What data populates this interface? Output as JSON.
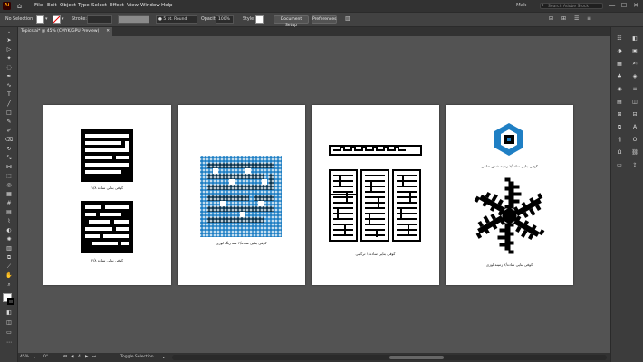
{
  "app": {
    "logo": "Ai",
    "home_icon": "home-icon"
  },
  "menu": [
    "File",
    "Edit",
    "Object",
    "Type",
    "Select",
    "Effect",
    "View",
    "Window",
    "Help"
  ],
  "workspace": "Mak",
  "search": {
    "placeholder": "Search Adobe Stock"
  },
  "window_controls": [
    "—",
    "☐",
    "✕"
  ],
  "control_bar": {
    "selection": "No Selection",
    "stroke_label": "Stroke:",
    "brush": "5 pt. Round",
    "opacity_label": "Opacity:",
    "opacity_value": "100%",
    "style_label": "Style:",
    "document_setup": "Document Setup",
    "preferences": "Preferences"
  },
  "document_tab": {
    "title": "Topics.ai* @ 45% (CMYK/GPU Preview)",
    "close": "✕"
  },
  "artboards": [
    {
      "captions": [
        "کوفی بنایی ساده ۱/۸",
        "کوفی بنایی ساده ۲/۸"
      ]
    },
    {
      "captions": [
        "کوفی بنایی ساده/۲ سه رنگ لوزی"
      ]
    },
    {
      "captions": [
        "کوفی بنایی ساده/۱ ترکیبی"
      ]
    },
    {
      "captions": [
        "کوفی بنایی ساده/۱ زمینه شش ضلعی",
        "کوفی بنایی ساده/۲ زمینه لوزی"
      ]
    }
  ],
  "status_bar": {
    "zoom": "45%",
    "angle": "0°",
    "page": "4",
    "mode": "Toggle Selection"
  },
  "colors": {
    "accent_blue": "#1f7fc4",
    "dark_blue": "#0b3550",
    "ai_orange": "#ff9a00"
  }
}
